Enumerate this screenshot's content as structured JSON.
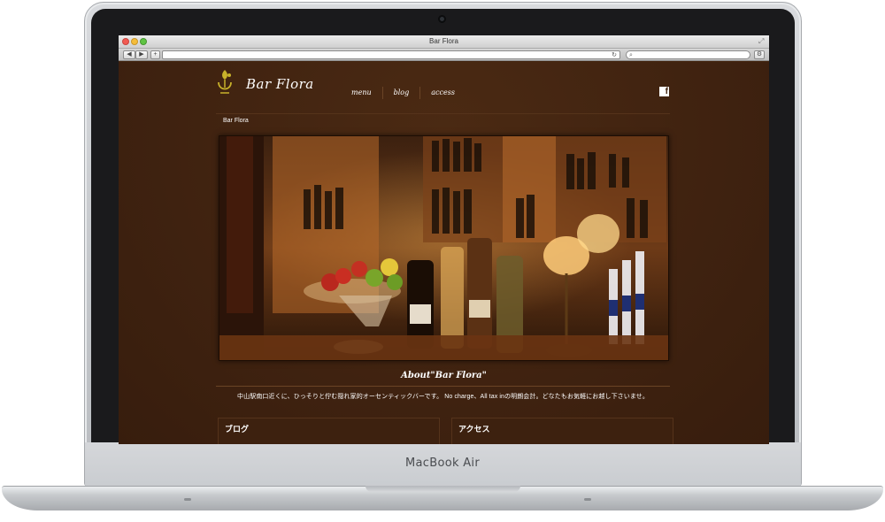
{
  "device": {
    "brand": "MacBook Air"
  },
  "window": {
    "title": "Bar Flora"
  },
  "toolbar": {
    "back": "◀",
    "forward": "▶",
    "add": "+"
  },
  "site": {
    "logo_text": "Bar Flora",
    "nav": [
      "menu",
      "blog",
      "access"
    ],
    "facebook": "f",
    "breadcrumb": "Bar Flora",
    "about_title": "About\"Bar Flora\"",
    "about_text": "中山駅南口近くに、ひっそりと佇む隠れ家的オーセンティックバーです。 No charge、All tax inの明朗会計。どなたもお気軽にお越し下さいませ。",
    "boxes": [
      "ブログ",
      "アクセス"
    ]
  },
  "colors": {
    "page_bg": "#432510",
    "accent_logo": "#c8b22a"
  }
}
